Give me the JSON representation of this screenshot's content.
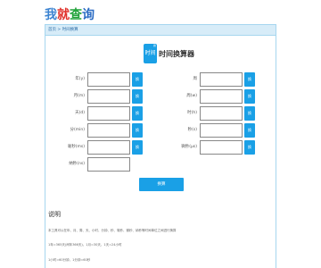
{
  "logo": {
    "c1": "我",
    "c2": "就",
    "c3": "查",
    "c4": "询"
  },
  "breadcrumb": "首页 > 时间换算",
  "header": {
    "icon_top": "换",
    "icon_label": "时间",
    "title": "时间换算器"
  },
  "fields": [
    {
      "left_label": "年(y)",
      "right_label": "周"
    },
    {
      "left_label": "月(m)",
      "right_label": "周(w)"
    },
    {
      "left_label": "天(d)",
      "right_label": "时(h)"
    },
    {
      "left_label": "分(min)",
      "right_label": "秒(s)"
    },
    {
      "left_label": "毫秒(ms)",
      "right_label": "微秒(μs)"
    },
    {
      "left_label": "纳秒(ns)"
    }
  ],
  "unit_button": "换",
  "calc_button": "换算",
  "notes": {
    "title": "说明",
    "lines": [
      "本工具可以在年、月、周、天、小时、分钟、秒、毫秒、微秒、纳秒等时间单位之间进行换算",
      "1年=365天(闰年366天)，1月=30天，1天=24小时",
      "1小时=60分钟，1分钟=60秒"
    ]
  }
}
